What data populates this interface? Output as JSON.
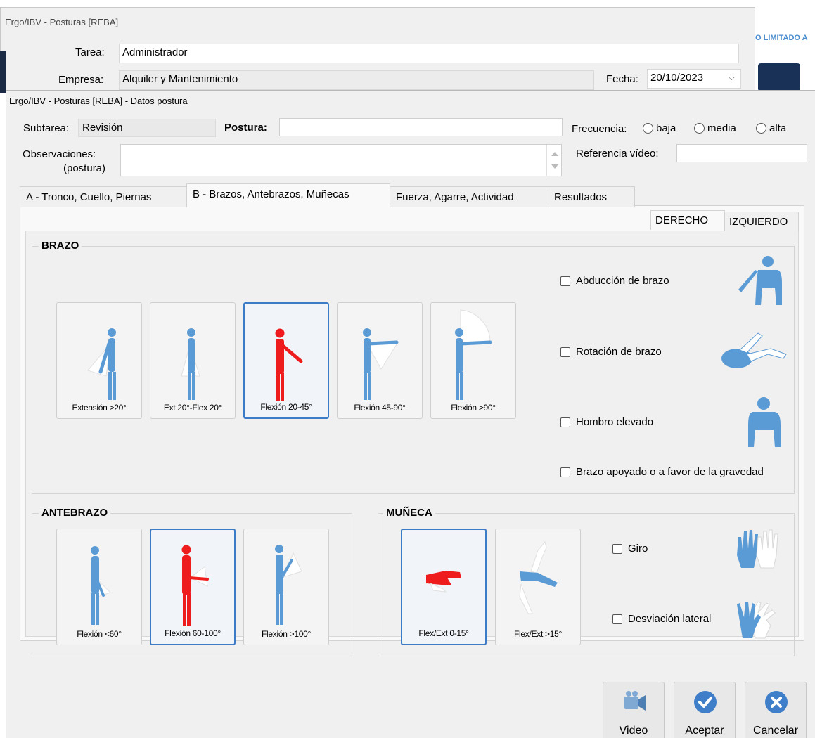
{
  "background_window": {
    "title": "Ergo/IBV - Posturas [REBA]",
    "tarea_label": "Tarea:",
    "tarea_value": "Administrador",
    "empresa_label": "Empresa:",
    "empresa_value": "Alquiler y Mantenimiento",
    "fecha_label": "Fecha:",
    "fecha_value": "20/10/2023",
    "right_edge_text": "O LIMITADO A"
  },
  "dialog": {
    "title": "Ergo/IBV - Posturas [REBA] - Datos postura",
    "subtarea_label": "Subtarea:",
    "subtarea_value": "Revisión",
    "postura_label": "Postura:",
    "postura_value": "",
    "frecuencia_label": "Frecuencia:",
    "frecuencia_options": [
      "baja",
      "media",
      "alta"
    ],
    "observaciones_label_1": "Observaciones:",
    "observaciones_label_2": "(postura)",
    "observaciones_value": "",
    "referencia_label": "Referencia vídeo:",
    "referencia_value": ""
  },
  "tabs": [
    {
      "label": "A - Tronco, Cuello, Piernas",
      "active": false
    },
    {
      "label": "B - Brazos, Antebrazos, Muñecas",
      "active": true
    },
    {
      "label": "Fuerza, Agarre, Actividad",
      "active": false
    },
    {
      "label": "Resultados",
      "active": false
    }
  ],
  "side_tabs": [
    {
      "label": "DERECHO",
      "active": true
    },
    {
      "label": "IZQUIERDO",
      "active": false
    }
  ],
  "brazo": {
    "title": "BRAZO",
    "options": [
      "Extensión >20°",
      "Ext 20°-Flex 20°",
      "Flexión 20-45°",
      "Flexión 45-90°",
      "Flexión >90°"
    ],
    "selected": "Flexión 20-45°",
    "checks": [
      "Abducción de brazo",
      "Rotación de brazo",
      "Hombro elevado",
      "Brazo apoyado o a favor de la gravedad"
    ]
  },
  "antebrazo": {
    "title": "ANTEBRAZO",
    "options": [
      "Flexión <60°",
      "Flexión 60-100°",
      "Flexión >100°"
    ],
    "selected": "Flexión 60-100°"
  },
  "muneca": {
    "title": "MUÑECA",
    "options": [
      "Flex/Ext 0-15°",
      "Flex/Ext >15°"
    ],
    "selected": "Flex/Ext 0-15°",
    "checks": [
      "Giro",
      "Desviación lateral"
    ]
  },
  "buttons": {
    "video": "Video",
    "aceptar": "Aceptar",
    "cancelar": "Cancelar"
  },
  "colors": {
    "figure_blue": "#5b9bd5",
    "figure_red": "#ee1c1c",
    "selected_border": "#3c7bc5",
    "button_icon_blue": "#3f7ec9"
  }
}
